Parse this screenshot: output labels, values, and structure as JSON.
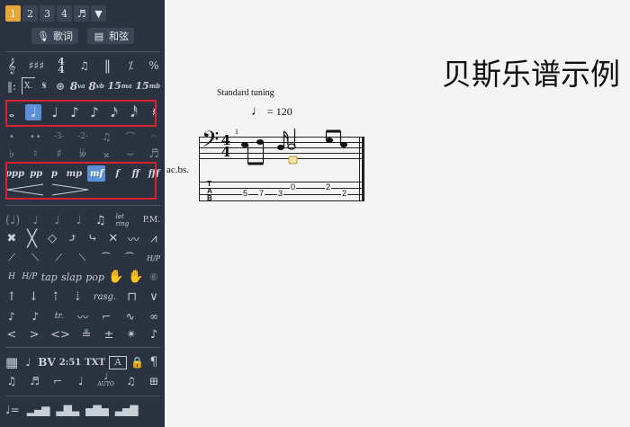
{
  "sidebar": {
    "tabs": [
      {
        "label": "1",
        "active": true
      },
      {
        "label": "2",
        "active": false
      },
      {
        "label": "3",
        "active": false
      },
      {
        "label": "4",
        "active": false
      }
    ],
    "lyrics_button": "歌词",
    "chords_button": "和弦",
    "palette_symbols": {
      "row_clefs": [
        "𝄞",
        "♯♯♯",
        "𝄴",
        "𝄌",
        "𝄂",
        "𝄎",
        "%"
      ],
      "row_misc": [
        "𝄆",
        "X.",
        "𝄌",
        "8va",
        "8vb",
        "15ma",
        "15mb"
      ],
      "row_durations": [
        "𝅝",
        "𝅗𝅥",
        "♩",
        "♪",
        "♪",
        "𝅘𝅥𝅯",
        "𝅘𝅥𝅰",
        "𝄽"
      ],
      "row_tuplets": [
        "♭",
        "♮",
        "♯",
        "-3-",
        "-2-",
        "♩",
        "𝄐"
      ],
      "row_dynamics": [
        "ppp",
        "pp",
        "p",
        "mp",
        "mf",
        "f",
        "ff",
        "fff"
      ],
      "row_hairpins": [
        "<",
        ">"
      ],
      "row_bv": [
        "BV",
        "2:51",
        "TXT",
        "A",
        "¶"
      ],
      "row_techniques": [
        "tap",
        "slap",
        "pop"
      ],
      "row_rasg": "rasg.",
      "row_pm": "P.M.",
      "row_let_ring": "let ring",
      "row_tr": "tr.",
      "row_h_po": "H/P",
      "row_auto": "AUTO"
    },
    "selected_duration_index": 1,
    "selected_dynamic": "mf"
  },
  "score": {
    "title": "贝斯乐谱示例",
    "tuning": "Standard tuning",
    "tempo_value": "= 120",
    "track_label": "ac.bs.",
    "time_signature": {
      "top": "4",
      "bottom": "4"
    },
    "measure_number": "1",
    "tab_letters": [
      "T",
      "A",
      "B"
    ],
    "tab_numbers": [
      {
        "n": "5",
        "string": 3
      },
      {
        "n": "7",
        "string": 3
      },
      {
        "n": "3",
        "string": 3
      },
      {
        "n": "0",
        "string": 1
      },
      {
        "n": "2",
        "string": 1
      },
      {
        "n": "2",
        "string": 3
      }
    ]
  }
}
